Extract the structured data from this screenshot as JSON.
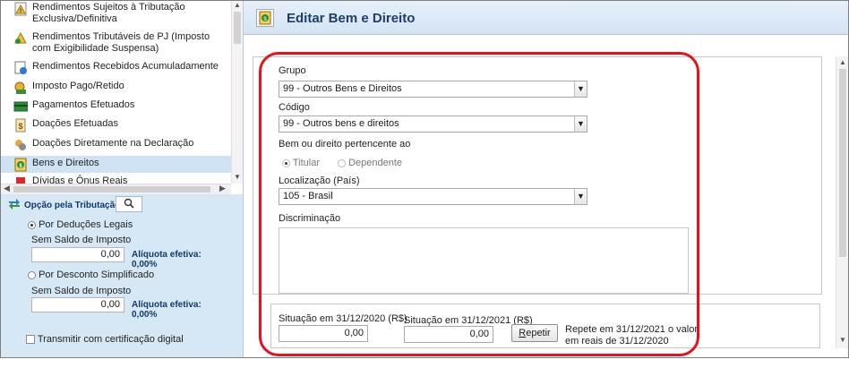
{
  "sidebar": {
    "items": [
      {
        "label": "Rendimentos Sujeitos à Tributação Exclusiva/Definitiva",
        "icon": "warning-doc-icon"
      },
      {
        "label": "Rendimentos Tributáveis de PJ (Imposto com Exigibilidade Suspensa)",
        "icon": "pj-suspensa-icon"
      },
      {
        "label": "Rendimentos Recebidos Acumuladamente",
        "icon": "accumulated-income-icon"
      },
      {
        "label": "Imposto Pago/Retido",
        "icon": "tax-paid-icon"
      },
      {
        "label": "Pagamentos Efetuados",
        "icon": "payment-card-icon"
      },
      {
        "label": "Doações Efetuadas",
        "icon": "donation-icon"
      },
      {
        "label": "Doações Diretamente na Declaração",
        "icon": "direct-donation-icon"
      },
      {
        "label": "Bens e Direitos",
        "icon": "assets-icon"
      },
      {
        "label": "Dívidas e Ônus Reais",
        "icon": "debts-icon"
      }
    ]
  },
  "opcao": {
    "title": "Opção pela Tributação:",
    "deducoes_label": "Por Deduções Legais",
    "sem_saldo_1": "Sem Saldo de Imposto",
    "valor_1": "0,00",
    "aliquota_1": "Alíquota efetiva: 0,00%",
    "simplificado_label": "Por Desconto Simplificado",
    "sem_saldo_2": "Sem Saldo de Imposto",
    "valor_2": "0,00",
    "aliquota_2": "Alíquota efetiva: 0,00%",
    "transmitir_label": "Transmitir com certificação digital"
  },
  "header": {
    "title": "Editar Bem e Direito"
  },
  "form": {
    "grupo_label": "Grupo",
    "grupo_value": "99 - Outros Bens e Direitos",
    "codigo_label": "Código",
    "codigo_value": "99 - Outros bens e direitos",
    "pertencente_label": "Bem ou direito pertencente ao",
    "titular_label": "Titular",
    "dependente_label": "Dependente",
    "localizacao_label": "Localização (País)",
    "localizacao_value": "105 - Brasil",
    "discriminacao_label": "Discriminação"
  },
  "situacao": {
    "s2020_label": "Situação em 31/12/2020 (R$)",
    "s2020_value": "0,00",
    "s2021_label": "Situação em 31/12/2021 (R$)",
    "s2021_value": "0,00",
    "repetir_label": "epetir",
    "repetir_hotkey": "R",
    "repete_note_1": "Repete em 31/12/2021 o valor",
    "repete_note_2": "em reais de 31/12/2020"
  },
  "colors": {
    "highlight": "#e8111b",
    "header_title": "#1d3e6a",
    "panel_blue": "#d6e8f6"
  }
}
